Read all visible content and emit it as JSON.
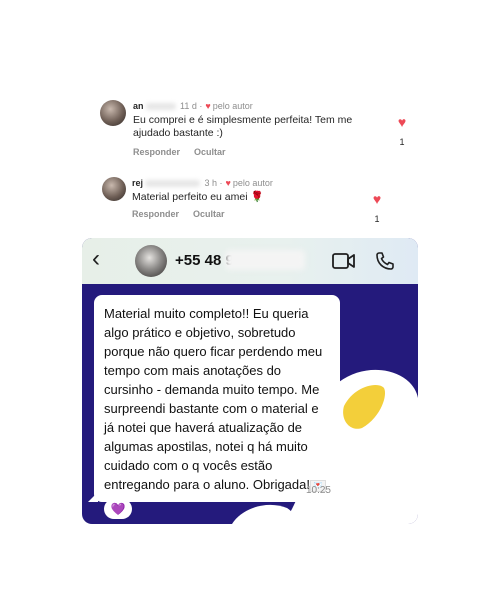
{
  "comments": [
    {
      "user": "an",
      "time": "11 d",
      "liked_by": "pelo autor",
      "text": "Eu comprei e é simplesmente perfeita! Tem me ajudado bastante :)",
      "reply": "Responder",
      "hide": "Ocultar",
      "likes": "1"
    },
    {
      "user": "rej",
      "time": "3 h",
      "liked_by": "pelo autor",
      "text": "Material perfeito eu amei 🌹",
      "reply": "Responder",
      "hide": "Ocultar",
      "likes": "1"
    }
  ],
  "whatsapp": {
    "contact": "+55 48 9",
    "message": "Material muito completo!! Eu queria algo prático e objetivo, sobretudo porque não quero ficar perdendo meu tempo com mais anotações do cursinho - demanda muito tempo. Me surpreendi bastante com o material e já notei que haverá atualização de algumas apostilas, notei q há muito cuidado com o q vocês estão entregando para o aluno. Obrigada!",
    "message_emoji": "💌",
    "time": "10:25",
    "reaction": "💜",
    "colors": {
      "background": "#241a7c",
      "header": "#e7efe8",
      "bubble": "#ffffff",
      "accent_heart": "#ed4956"
    }
  }
}
